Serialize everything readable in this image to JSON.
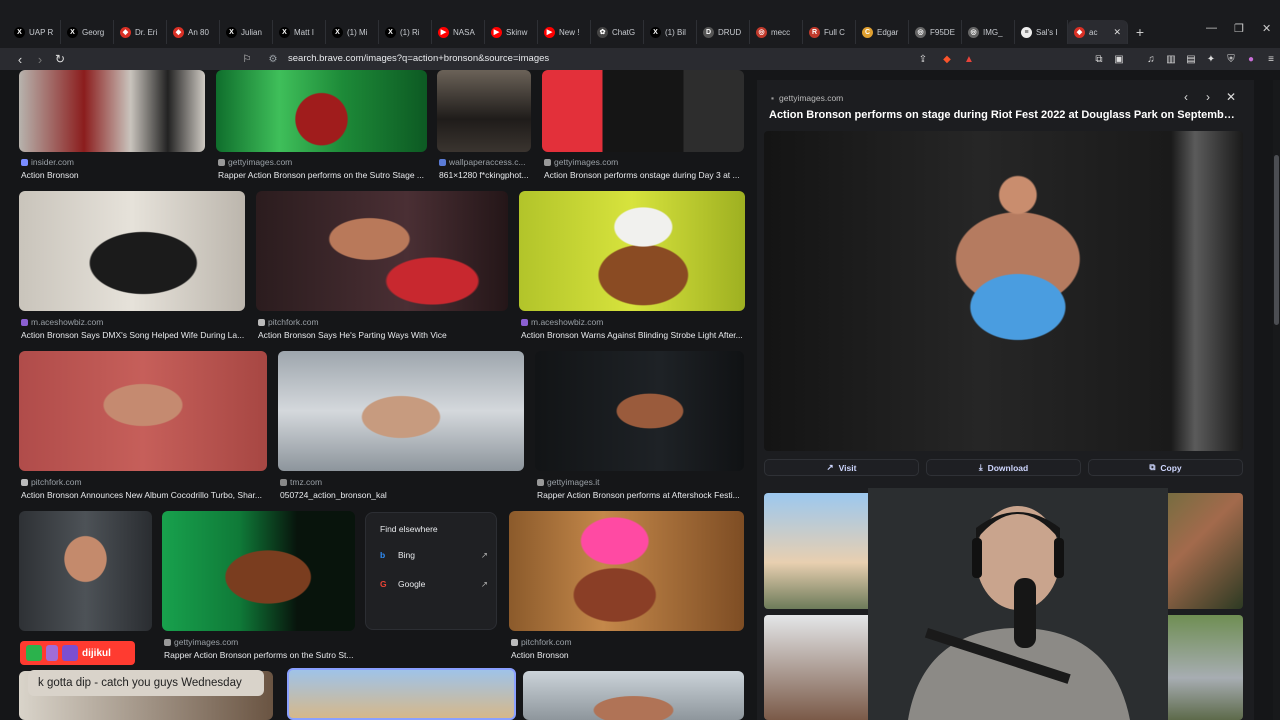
{
  "tabs": [
    {
      "label": "UAP R",
      "icon": "x-icon",
      "color": "#000"
    },
    {
      "label": "Georg",
      "icon": "x-icon",
      "color": "#000"
    },
    {
      "label": "Dr. Eri",
      "icon": "brave-icon",
      "color": "#d93025"
    },
    {
      "label": "An 80",
      "icon": "brave-icon",
      "color": "#d93025"
    },
    {
      "label": "Julian",
      "icon": "x-icon",
      "color": "#000"
    },
    {
      "label": "Matt I",
      "icon": "x-icon",
      "color": "#000"
    },
    {
      "label": "(1) Mi",
      "icon": "x-icon",
      "color": "#000"
    },
    {
      "label": "(1) Ri",
      "icon": "x-icon",
      "color": "#000"
    },
    {
      "label": "NASA",
      "icon": "youtube-icon",
      "color": "#ff0000"
    },
    {
      "label": "Skinw",
      "icon": "youtube-icon",
      "color": "#ff0000"
    },
    {
      "label": "New !",
      "icon": "youtube-icon",
      "color": "#ff0000"
    },
    {
      "label": "ChatG",
      "icon": "openai-icon",
      "color": "#444"
    },
    {
      "label": "(1) Bil",
      "icon": "x-icon",
      "color": "#000"
    },
    {
      "label": "DRUD",
      "icon": "drudge-icon",
      "color": "#555"
    },
    {
      "label": "mecc",
      "icon": "globe-icon",
      "color": "#c0392b"
    },
    {
      "label": "Full C",
      "icon": "rumble-icon",
      "color": "#c0392b"
    },
    {
      "label": "Edgar",
      "icon": "coin-icon",
      "color": "#e0a030"
    },
    {
      "label": "F95DE",
      "icon": "globe-icon",
      "color": "#666"
    },
    {
      "label": "IMG_",
      "icon": "globe-icon",
      "color": "#666"
    },
    {
      "label": "Sal's I",
      "icon": "doc-icon",
      "color": "#eee"
    },
    {
      "label": "ac",
      "icon": "brave-icon",
      "color": "#d93025",
      "active": true
    }
  ],
  "url": "search.brave.com/images?q=action+bronson&source=images",
  "results": [
    {
      "source": "insider.com",
      "caption": "Action Bronson"
    },
    {
      "source": "gettyimages.com",
      "caption": "Rapper Action Bronson performs on the Sutro Stage ..."
    },
    {
      "source": "wallpaperaccess.c...",
      "caption": "861×1280 f*ckingphot..."
    },
    {
      "source": "gettyimages.com",
      "caption": "Action Bronson performs onstage during Day 3 at ..."
    },
    {
      "source": "m.aceshowbiz.com",
      "caption": "Action Bronson Says DMX's Song Helped Wife During La..."
    },
    {
      "source": "pitchfork.com",
      "caption": "Action Bronson Says He's Parting Ways With Vice"
    },
    {
      "source": "m.aceshowbiz.com",
      "caption": "Action Bronson Warns Against Blinding Strobe Light After..."
    },
    {
      "source": "pitchfork.com",
      "caption": "Action Bronson Announces New Album Cocodrillo Turbo, Shar..."
    },
    {
      "source": "tmz.com",
      "caption": "050724_action_bronson_kal"
    },
    {
      "source": "gettyimages.it",
      "caption": "Rapper Action Bronson performs at Aftershock Festi..."
    },
    {
      "source": "gettyimages.com",
      "caption": "Rapper Action Bronson performs on the Sutro St..."
    },
    {
      "source": "pitchfork.com",
      "caption": "Action Bronson"
    }
  ],
  "find_elsewhere": {
    "heading": "Find elsewhere",
    "engines": [
      {
        "name": "Bing"
      },
      {
        "name": "Google"
      }
    ]
  },
  "panel": {
    "source": "gettyimages.com",
    "title": "Action Bronson performs on stage during Riot Fest 2022 at Douglass Park on September ...",
    "visit": "Visit",
    "download": "Download",
    "copy": "Copy"
  },
  "overlay": {
    "username": "dijikul",
    "message": "k gotta dip - catch you guys Wednesday"
  }
}
